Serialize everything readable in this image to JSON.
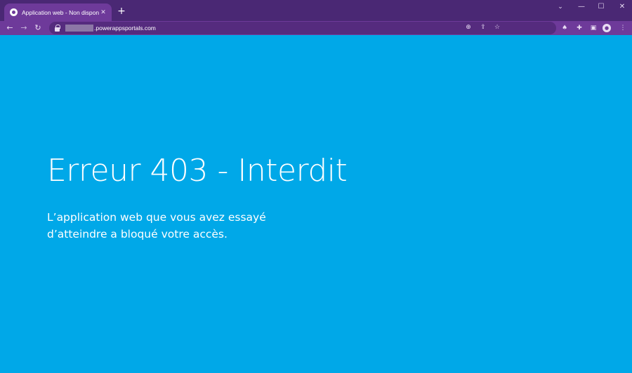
{
  "browser": {
    "tab_title": "Application web - Non disponible",
    "tab_close": "✕",
    "new_tab": "+",
    "window_controls": {
      "list": "⌄",
      "minimize": "—",
      "maximize": "☐",
      "close": "✕"
    },
    "nav": {
      "back": "←",
      "forward": "→",
      "reload": "↻"
    },
    "url_suffix": ".powerappsportals.com",
    "omnibox_icons": {
      "zoom": "⊕",
      "share": "⇪",
      "star": "☆"
    },
    "toolbar_icons": {
      "extension1": "♠",
      "extensions": "✚",
      "side_panel": "▣",
      "profile": "●",
      "menu": "⋮"
    }
  },
  "page": {
    "error_title": "Erreur 403 - Interdit",
    "error_line1": "L’application web que vous avez essayé",
    "error_line2": "d’atteindre a bloqué votre accès."
  },
  "colors": {
    "page_background": "#00a8e8",
    "titlebar": "#4a2874",
    "toolbar": "#6e3a9a",
    "text": "#ffffff"
  }
}
